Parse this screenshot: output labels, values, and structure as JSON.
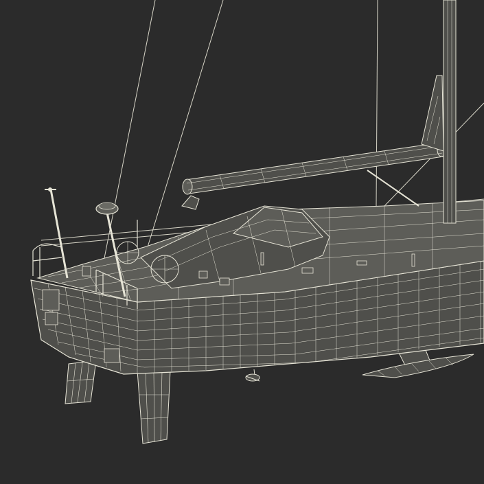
{
  "scene": {
    "subject": "sailboat-wireframe-render",
    "colors": {
      "background": "#2b2b2b",
      "wire": "#e6e4d6",
      "surface": "#4f4f4b",
      "surface_light": "#5d5d58"
    }
  }
}
